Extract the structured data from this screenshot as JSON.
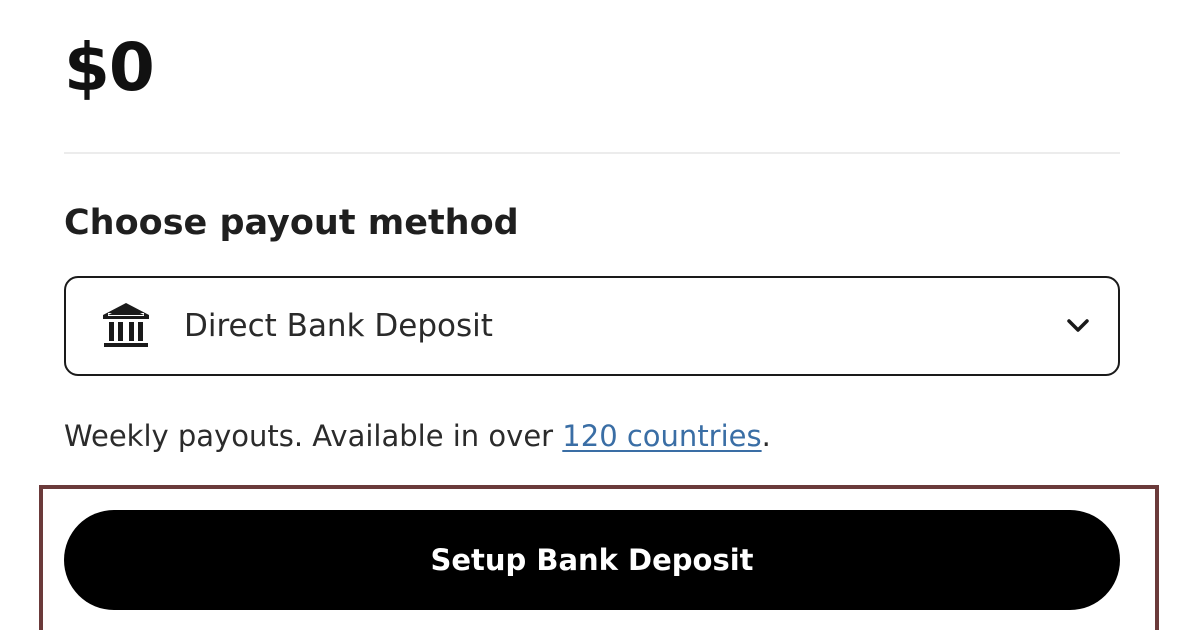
{
  "balance": {
    "amount": "$0"
  },
  "payout": {
    "section_title": "Choose payout method",
    "select": {
      "selected_value": "Direct Bank Deposit",
      "icon": "bank-icon",
      "chevron_icon": "chevron-down-icon"
    },
    "helper": {
      "prefix": "Weekly payouts. Available in over ",
      "link_text": "120 countries",
      "suffix": "."
    },
    "cta_label": "Setup Bank Deposit"
  },
  "colors": {
    "text": "#1a1a1a",
    "link": "#3a6ea5",
    "button_bg": "#000000",
    "button_text": "#ffffff",
    "focus_frame": "#6b3a3a",
    "divider": "#ececec"
  }
}
